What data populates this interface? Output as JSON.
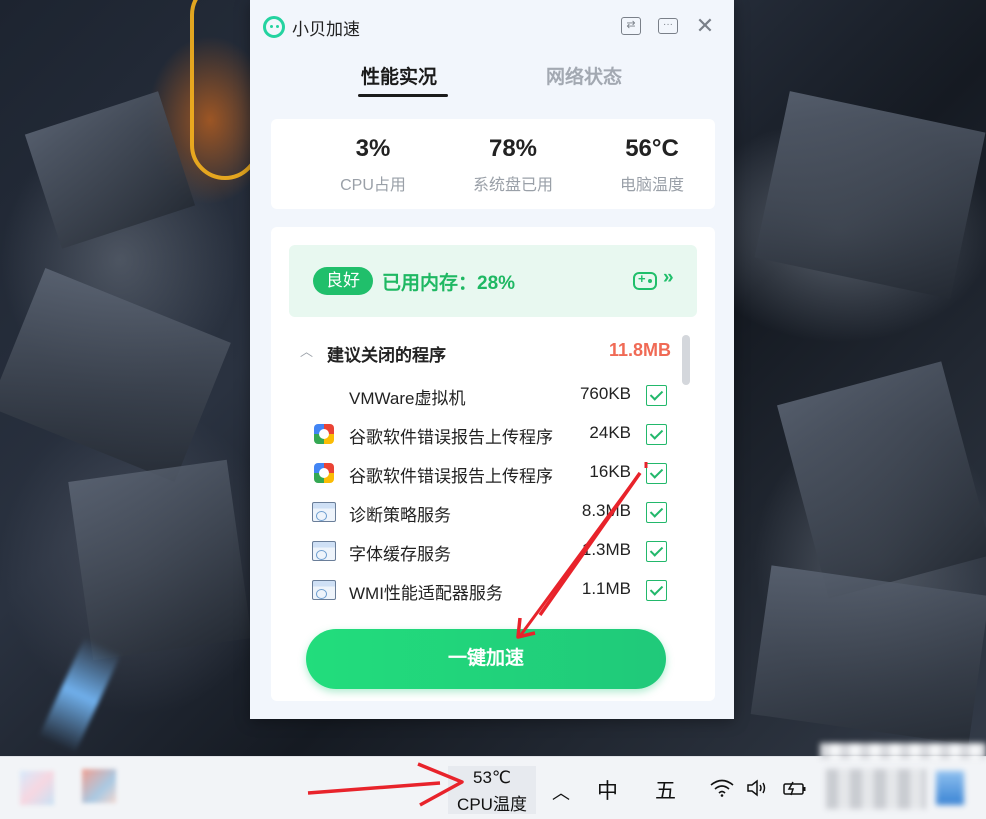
{
  "window": {
    "title": "小贝加速",
    "buttons": [
      "switch-icon",
      "feedback-icon",
      "close-icon"
    ]
  },
  "tabs": [
    {
      "label": "性能实况",
      "active": true
    },
    {
      "label": "网络状态",
      "active": false
    }
  ],
  "stats": [
    {
      "value": "3%",
      "label": "CPU占用"
    },
    {
      "value": "78%",
      "label": "系统盘已用"
    },
    {
      "value": "56°C",
      "label": "电脑温度"
    }
  ],
  "memory": {
    "badge": "良好",
    "text": "已用内存：28%",
    "more": "»"
  },
  "section": {
    "title": "建议关闭的程序",
    "total": "11.8MB"
  },
  "programs": [
    {
      "name": "VMWare虚拟机",
      "size": "760KB",
      "icon": "none",
      "checked": true
    },
    {
      "name": "谷歌软件错误报告上传程序",
      "size": "24KB",
      "icon": "google-updater-icon",
      "checked": true
    },
    {
      "name": "谷歌软件错误报告上传程序",
      "size": "16KB",
      "icon": "google-updater-icon",
      "checked": true
    },
    {
      "name": "诊断策略服务",
      "size": "8.3MB",
      "icon": "service-icon",
      "checked": true
    },
    {
      "name": "字体缓存服务",
      "size": "1.3MB",
      "icon": "service-icon",
      "checked": true
    },
    {
      "name": "WMI性能适配器服务",
      "size": "1.1MB",
      "icon": "service-icon",
      "checked": true
    }
  ],
  "boost_button": "一键加速",
  "taskbar": {
    "temp_value": "53℃",
    "temp_label": "CPU温度",
    "tray_up": "^",
    "ime_lang": "中",
    "ime_mode": "五"
  },
  "colors": {
    "accent_green": "#20bf6b",
    "warning_red": "#f06a55",
    "annotation_red": "#e8232b"
  }
}
